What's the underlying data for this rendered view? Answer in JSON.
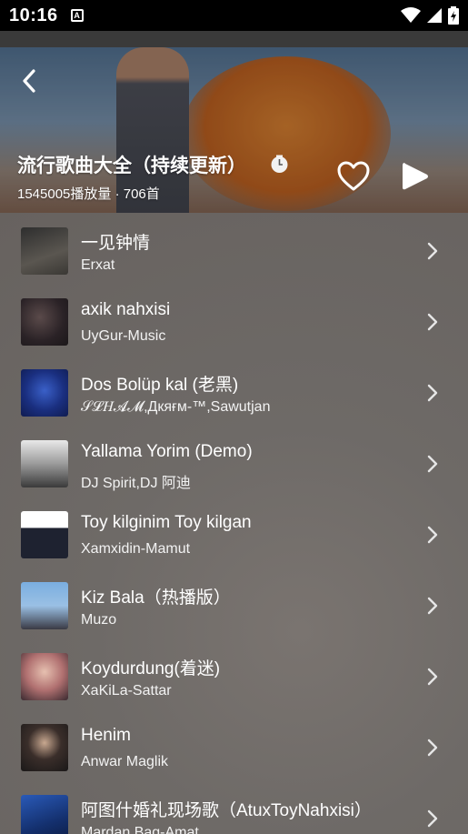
{
  "status_bar": {
    "time": "10:16",
    "notif": "A"
  },
  "header": {
    "title": "流行歌曲大全（持续更新）",
    "stats": "1545005播放量 · 706首"
  },
  "colors": {
    "list_bg": "#6e6a67",
    "status_bg": "#000000",
    "text": "#ffffff"
  },
  "songs": [
    {
      "title": "一见钟情",
      "artist": "Erxat"
    },
    {
      "title": "axik nahxisi",
      "artist": "UyGur-Music"
    },
    {
      "title": "Dos Bolüp kal (老黑)",
      "artist": "𝒮𝓛𝐻𝓐𝓜,Дкяғм-™,Sawutjan"
    },
    {
      "title": "Yallama Yorim (Demo)",
      "artist": "DJ Spirit,DJ 阿迪"
    },
    {
      "title": "Toy kilginim Toy kilgan",
      "artist": "Xamxidin-Mamut"
    },
    {
      "title": "Kiz Bala（热播版）",
      "artist": "Muzo"
    },
    {
      "title": "Koydurdung(着迷)",
      "artist": "XaKiLa-Sattar"
    },
    {
      "title": "Henim",
      "artist": "Anwar Maglik"
    },
    {
      "title": "阿图什婚礼现场歌（AtuxToyNahxisi）",
      "artist": "Mardan Bag-Amat"
    }
  ]
}
